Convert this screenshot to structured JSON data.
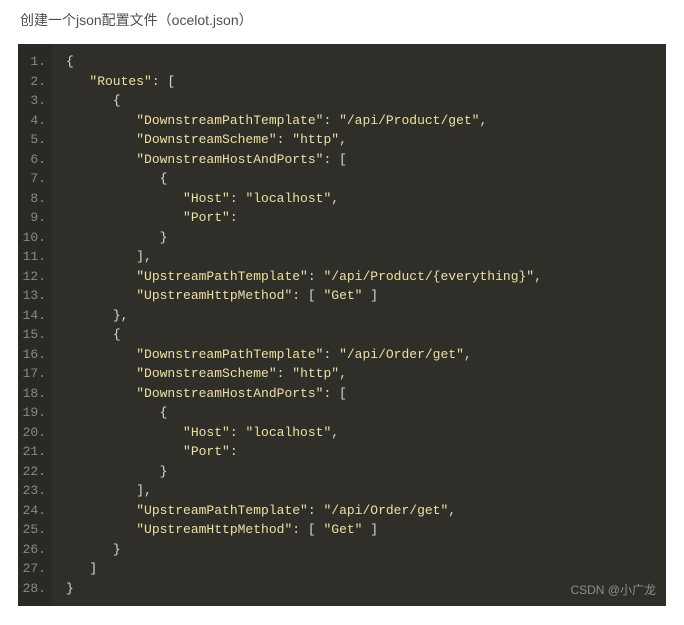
{
  "title": "创建一个json配置文件（ocelot.json）",
  "watermark": "CSDN @小广龙",
  "lines": [
    {
      "n": "1.",
      "indent": 0,
      "tokens": [
        {
          "c": "p",
          "t": "{"
        }
      ]
    },
    {
      "n": "2.",
      "indent": 1,
      "tokens": [
        {
          "c": "k",
          "t": "\"Routes\""
        },
        {
          "c": "p",
          "t": ": ["
        }
      ]
    },
    {
      "n": "3.",
      "indent": 2,
      "tokens": [
        {
          "c": "p",
          "t": "{"
        }
      ]
    },
    {
      "n": "4.",
      "indent": 3,
      "tokens": [
        {
          "c": "k",
          "t": "\"DownstreamPathTemplate\""
        },
        {
          "c": "p",
          "t": ": "
        },
        {
          "c": "k",
          "t": "\"/api/Product/get\""
        },
        {
          "c": "p",
          "t": ","
        }
      ]
    },
    {
      "n": "5.",
      "indent": 3,
      "tokens": [
        {
          "c": "k",
          "t": "\"DownstreamScheme\""
        },
        {
          "c": "p",
          "t": ": "
        },
        {
          "c": "k",
          "t": "\"http\""
        },
        {
          "c": "p",
          "t": ","
        }
      ]
    },
    {
      "n": "6.",
      "indent": 3,
      "tokens": [
        {
          "c": "k",
          "t": "\"DownstreamHostAndPorts\""
        },
        {
          "c": "p",
          "t": ": ["
        }
      ]
    },
    {
      "n": "7.",
      "indent": 4,
      "tokens": [
        {
          "c": "p",
          "t": "{"
        }
      ]
    },
    {
      "n": "8.",
      "indent": 5,
      "tokens": [
        {
          "c": "k",
          "t": "\"Host\""
        },
        {
          "c": "p",
          "t": ": "
        },
        {
          "c": "k",
          "t": "\"localhost\""
        },
        {
          "c": "p",
          "t": ","
        }
      ]
    },
    {
      "n": "9.",
      "indent": 5,
      "tokens": [
        {
          "c": "k",
          "t": "\"Port\""
        },
        {
          "c": "p",
          "t": ": "
        }
      ]
    },
    {
      "n": "10.",
      "indent": 4,
      "tokens": [
        {
          "c": "p",
          "t": "}"
        }
      ]
    },
    {
      "n": "11.",
      "indent": 3,
      "tokens": [
        {
          "c": "p",
          "t": "],"
        }
      ]
    },
    {
      "n": "12.",
      "indent": 3,
      "tokens": [
        {
          "c": "k",
          "t": "\"UpstreamPathTemplate\""
        },
        {
          "c": "p",
          "t": ": "
        },
        {
          "c": "k",
          "t": "\"/api/Product/{everything}\""
        },
        {
          "c": "p",
          "t": ","
        }
      ]
    },
    {
      "n": "13.",
      "indent": 3,
      "tokens": [
        {
          "c": "k",
          "t": "\"UpstreamHttpMethod\""
        },
        {
          "c": "p",
          "t": ": [ "
        },
        {
          "c": "k",
          "t": "\"Get\""
        },
        {
          "c": "p",
          "t": " ]"
        }
      ]
    },
    {
      "n": "14.",
      "indent": 2,
      "tokens": [
        {
          "c": "p",
          "t": "},"
        }
      ]
    },
    {
      "n": "15.",
      "indent": 2,
      "tokens": [
        {
          "c": "p",
          "t": "{"
        }
      ]
    },
    {
      "n": "16.",
      "indent": 3,
      "tokens": [
        {
          "c": "k",
          "t": "\"DownstreamPathTemplate\""
        },
        {
          "c": "p",
          "t": ": "
        },
        {
          "c": "k",
          "t": "\"/api/Order/get\""
        },
        {
          "c": "p",
          "t": ","
        }
      ]
    },
    {
      "n": "17.",
      "indent": 3,
      "tokens": [
        {
          "c": "k",
          "t": "\"DownstreamScheme\""
        },
        {
          "c": "p",
          "t": ": "
        },
        {
          "c": "k",
          "t": "\"http\""
        },
        {
          "c": "p",
          "t": ","
        }
      ]
    },
    {
      "n": "18.",
      "indent": 3,
      "tokens": [
        {
          "c": "k",
          "t": "\"DownstreamHostAndPorts\""
        },
        {
          "c": "p",
          "t": ": ["
        }
      ]
    },
    {
      "n": "19.",
      "indent": 4,
      "tokens": [
        {
          "c": "p",
          "t": "{"
        }
      ]
    },
    {
      "n": "20.",
      "indent": 5,
      "tokens": [
        {
          "c": "k",
          "t": "\"Host\""
        },
        {
          "c": "p",
          "t": ": "
        },
        {
          "c": "k",
          "t": "\"localhost\""
        },
        {
          "c": "p",
          "t": ","
        }
      ]
    },
    {
      "n": "21.",
      "indent": 5,
      "tokens": [
        {
          "c": "k",
          "t": "\"Port\""
        },
        {
          "c": "p",
          "t": ": "
        }
      ]
    },
    {
      "n": "22.",
      "indent": 4,
      "tokens": [
        {
          "c": "p",
          "t": "}"
        }
      ]
    },
    {
      "n": "23.",
      "indent": 3,
      "tokens": [
        {
          "c": "p",
          "t": "],"
        }
      ]
    },
    {
      "n": "24.",
      "indent": 3,
      "tokens": [
        {
          "c": "k",
          "t": "\"UpstreamPathTemplate\""
        },
        {
          "c": "p",
          "t": ": "
        },
        {
          "c": "k",
          "t": "\"/api/Order/get\""
        },
        {
          "c": "p",
          "t": ","
        }
      ]
    },
    {
      "n": "25.",
      "indent": 3,
      "tokens": [
        {
          "c": "k",
          "t": "\"UpstreamHttpMethod\""
        },
        {
          "c": "p",
          "t": ": [ "
        },
        {
          "c": "k",
          "t": "\"Get\""
        },
        {
          "c": "p",
          "t": " ]"
        }
      ]
    },
    {
      "n": "26.",
      "indent": 2,
      "tokens": [
        {
          "c": "p",
          "t": "}"
        }
      ]
    },
    {
      "n": "27.",
      "indent": 1,
      "tokens": [
        {
          "c": "p",
          "t": "]"
        }
      ]
    },
    {
      "n": "28.",
      "indent": 0,
      "tokens": [
        {
          "c": "p",
          "t": "}"
        }
      ]
    }
  ]
}
